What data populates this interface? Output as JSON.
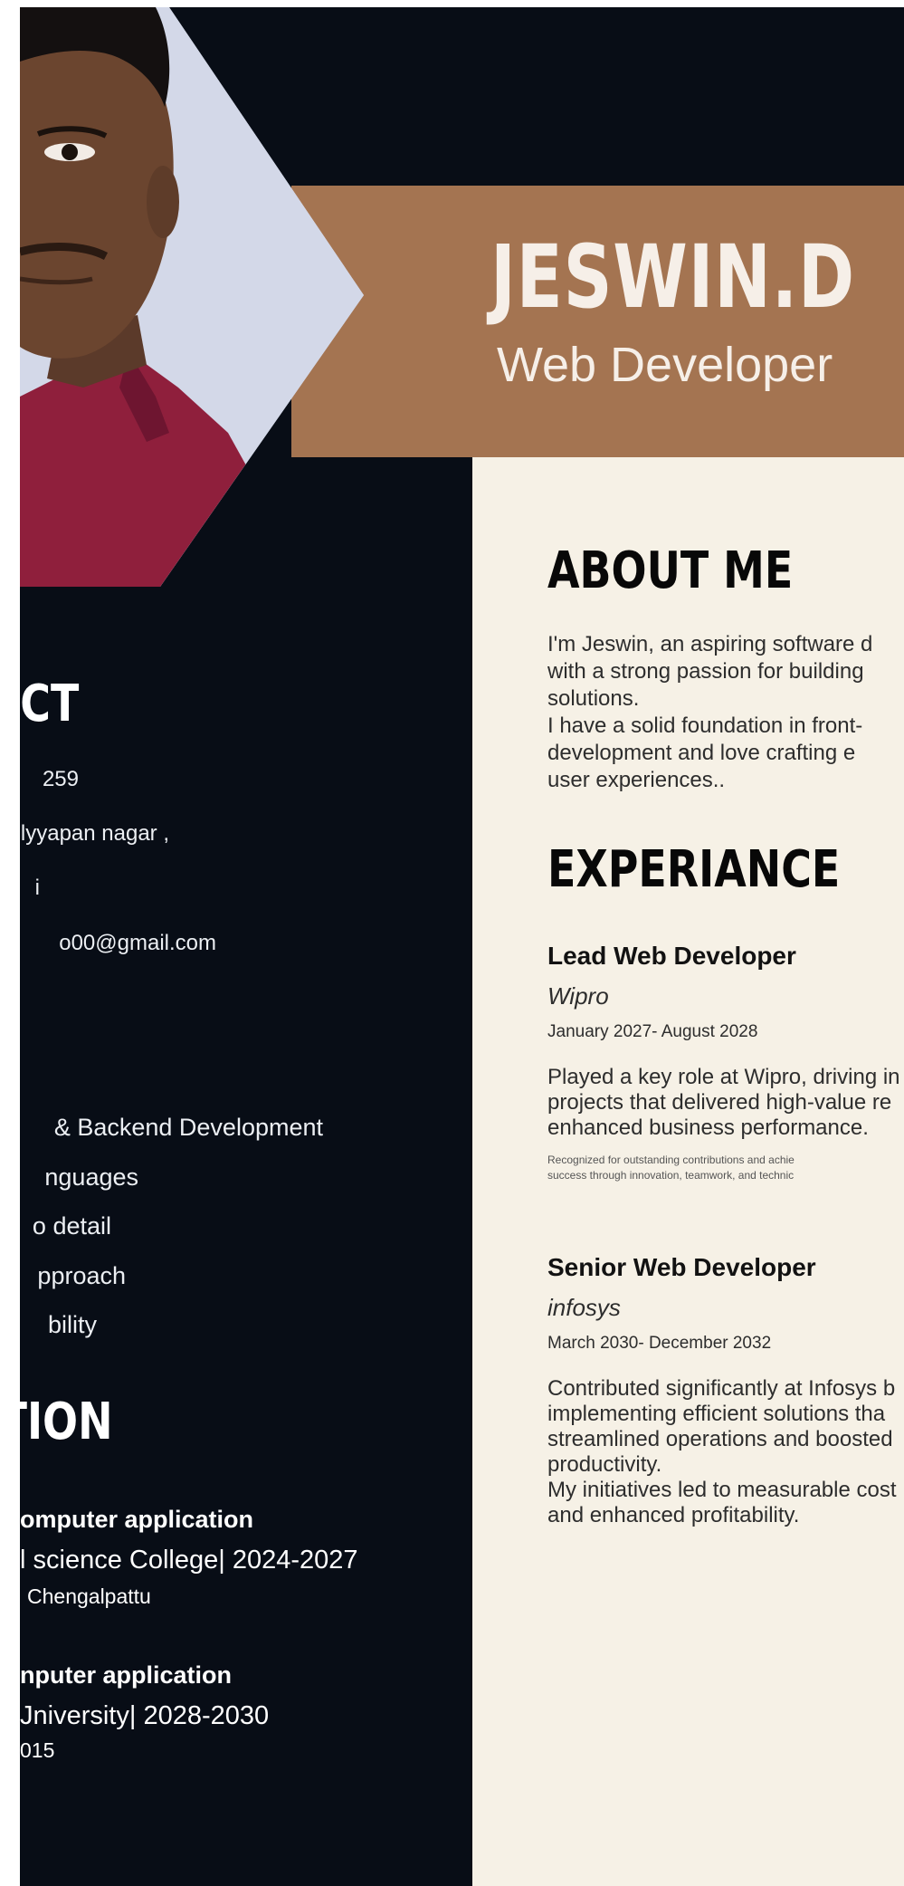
{
  "header": {
    "name": "JESWIN.D",
    "role": "Web Developer"
  },
  "contact": {
    "heading": "CT",
    "items": [
      "259",
      "lyyapan nagar ,",
      "i",
      "o00@gmail.com"
    ]
  },
  "skills": {
    "items": [
      "& Backend Development",
      "nguages",
      "o detail",
      "pproach",
      "bility"
    ]
  },
  "education": {
    "heading": "TION",
    "entries": [
      {
        "degree": "omputer application",
        "institution": "l science College| 2024-2027",
        "location": "Chengalpattu"
      },
      {
        "degree": "nputer application",
        "institution": "Jniversity| 2028-2030",
        "location": "015"
      }
    ]
  },
  "about": {
    "heading": "ABOUT ME",
    "lines": [
      "I'm Jeswin, an aspiring software d",
      "with a strong passion for building",
      "solutions.",
      "I have a solid foundation in front-",
      "development and love crafting e",
      "user experiences.."
    ]
  },
  "experience": {
    "heading": "EXPERIANCE",
    "jobs": [
      {
        "title": "Lead Web Developer",
        "company": "Wipro",
        "dates": "January 2027- August 2028",
        "lines": [
          "Played a key role at Wipro, driving in",
          "projects that delivered high-value re",
          "enhanced business performance."
        ],
        "small_lines": [
          "Recognized for outstanding contributions and achie",
          "success through innovation, teamwork, and technic"
        ]
      },
      {
        "title": "Senior Web Developer",
        "company": "infosys",
        "dates": "March 2030- December 2032",
        "lines": [
          "Contributed significantly at Infosys b",
          "implementing efficient solutions tha",
          "streamlined operations and boosted",
          "productivity.",
          "My initiatives led to measurable cost",
          "and enhanced profitability."
        ],
        "small_lines": []
      }
    ]
  },
  "colors": {
    "dark": "#080d16",
    "brown": "#a47451",
    "cream": "#f6f1e6"
  }
}
